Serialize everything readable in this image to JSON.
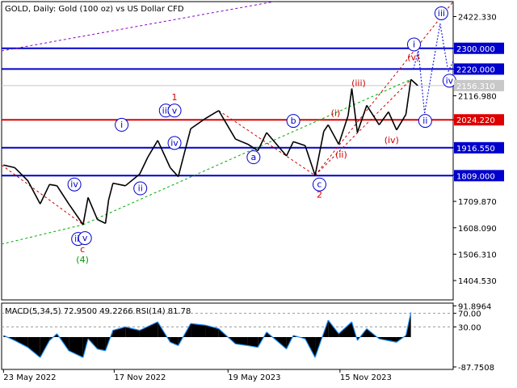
{
  "chart_data": {
    "type": "line",
    "title": "GOLD, Daily:  Gold (100 oz) vs US Dollar CFD",
    "price_axis": {
      "ylim": [
        1330,
        2480
      ],
      "tick_values": [
        1404.53,
        1506.31,
        1608.09,
        1709.87,
        1811.65,
        1916.55,
        2024.22,
        2116.98,
        2156.31,
        2220.0,
        2300.0,
        2422.33
      ],
      "tick_labels": [
        "1404.530",
        "1506.310",
        "1608.090",
        "1709.870",
        "1811.650",
        "1916.550",
        "2024.220",
        "2116.980",
        "2156.310",
        "2220.000",
        "2300.000",
        "2422.330"
      ]
    },
    "time_axis": {
      "range": [
        "2022-05-20",
        "2024-05-15"
      ],
      "labels": [
        {
          "date": "2022-05-23",
          "text": "23 May 2022"
        },
        {
          "date": "2022-11-17",
          "text": "17 Nov 2022"
        },
        {
          "date": "2023-05-19",
          "text": "19 May 2023"
        },
        {
          "date": "2023-11-15",
          "text": "15 Nov 2023"
        }
      ]
    },
    "price_series": [
      [
        "2022-05-23",
        1850
      ],
      [
        "2022-06-10",
        1840
      ],
      [
        "2022-07-01",
        1790
      ],
      [
        "2022-07-21",
        1700
      ],
      [
        "2022-08-05",
        1775
      ],
      [
        "2022-08-17",
        1770
      ],
      [
        "2022-09-05",
        1700
      ],
      [
        "2022-09-28",
        1620
      ],
      [
        "2022-10-06",
        1725
      ],
      [
        "2022-10-21",
        1640
      ],
      [
        "2022-11-03",
        1625
      ],
      [
        "2022-11-08",
        1715
      ],
      [
        "2022-11-15",
        1780
      ],
      [
        "2022-12-05",
        1770
      ],
      [
        "2022-12-28",
        1815
      ],
      [
        "2023-01-10",
        1880
      ],
      [
        "2023-01-26",
        1945
      ],
      [
        "2023-02-15",
        1840
      ],
      [
        "2023-02-28",
        1805
      ],
      [
        "2023-03-20",
        1990
      ],
      [
        "2023-04-13",
        2030
      ],
      [
        "2023-05-04",
        2060
      ],
      [
        "2023-05-31",
        1950
      ],
      [
        "2023-06-20",
        1930
      ],
      [
        "2023-07-06",
        1905
      ],
      [
        "2023-07-20",
        1975
      ],
      [
        "2023-08-21",
        1885
      ],
      [
        "2023-09-01",
        1940
      ],
      [
        "2023-09-20",
        1925
      ],
      [
        "2023-10-06",
        1810
      ],
      [
        "2023-10-20",
        1980
      ],
      [
        "2023-10-27",
        2005
      ],
      [
        "2023-11-13",
        1930
      ],
      [
        "2023-11-28",
        2040
      ],
      [
        "2023-12-04",
        2145
      ],
      [
        "2023-12-13",
        1975
      ],
      [
        "2023-12-28",
        2080
      ],
      [
        "2024-01-17",
        2005
      ],
      [
        "2024-02-01",
        2055
      ],
      [
        "2024-02-14",
        1985
      ],
      [
        "2024-02-29",
        2045
      ],
      [
        "2024-03-08",
        2180
      ],
      [
        "2024-03-19",
        2156.31
      ]
    ],
    "price_lines": [
      {
        "value": 2300.0,
        "label": "2300.000",
        "color": "#0000cc"
      },
      {
        "value": 2220.0,
        "label": "2220.000",
        "color": "#0000cc"
      },
      {
        "value": 2024.22,
        "label": "2024.220",
        "color": "#dd0000"
      },
      {
        "value": 1916.55,
        "label": "1916.550",
        "color": "#0000cc"
      },
      {
        "value": 1809.0,
        "label": "1809.000",
        "color": "#0000cc"
      }
    ],
    "current_price": {
      "value": 2156.31,
      "label": "2156.310"
    },
    "wave_labels": [
      {
        "text": "(4)",
        "date": "2022-09-27",
        "price": 1485,
        "color": "#009900",
        "circle": false
      },
      {
        "text": "c",
        "date": "2022-09-27",
        "price": 1525,
        "color": "#cc0000",
        "circle": false
      },
      {
        "text": "iii",
        "date": "2022-09-20",
        "price": 1565,
        "color": "#0000cc",
        "circle": true
      },
      {
        "text": "v",
        "date": "2022-10-01",
        "price": 1568,
        "color": "#0000cc",
        "circle": true
      },
      {
        "text": "iv",
        "date": "2022-09-14",
        "price": 1775,
        "color": "#0000cc",
        "circle": true
      },
      {
        "text": "i",
        "date": "2022-11-29",
        "price": 2005,
        "color": "#0000cc",
        "circle": true
      },
      {
        "text": "ii",
        "date": "2022-12-29",
        "price": 1760,
        "color": "#0000cc",
        "circle": true
      },
      {
        "text": "iii",
        "date": "2023-02-08",
        "price": 2060,
        "color": "#0000cc",
        "circle": true
      },
      {
        "text": "v",
        "date": "2023-02-22",
        "price": 2060,
        "color": "#0000cc",
        "circle": true
      },
      {
        "text": "iv",
        "date": "2023-02-22",
        "price": 1935,
        "color": "#0000cc",
        "circle": true
      },
      {
        "text": "1",
        "date": "2023-02-22",
        "price": 2110,
        "color": "#cc0000",
        "circle": false
      },
      {
        "text": "a",
        "date": "2023-06-29",
        "price": 1880,
        "color": "#0000cc",
        "circle": true
      },
      {
        "text": "b",
        "date": "2023-09-01",
        "price": 2020,
        "color": "#0000cc",
        "circle": true
      },
      {
        "text": "c",
        "date": "2023-10-13",
        "price": 1775,
        "color": "#0000cc",
        "circle": true
      },
      {
        "text": "2",
        "date": "2023-10-13",
        "price": 1735,
        "color": "#cc0000",
        "circle": false
      },
      {
        "text": "(i)",
        "date": "2023-11-08",
        "price": 2050,
        "color": "#cc0000",
        "circle": false
      },
      {
        "text": "(ii)",
        "date": "2023-11-17",
        "price": 1890,
        "color": "#cc0000",
        "circle": false
      },
      {
        "text": "(iii)",
        "date": "2023-12-15",
        "price": 2165,
        "color": "#cc0000",
        "circle": false
      },
      {
        "text": "(iv)",
        "date": "2024-02-06",
        "price": 1945,
        "color": "#cc0000",
        "circle": false
      },
      {
        "text": "(v)",
        "date": "2024-03-12",
        "price": 2265,
        "color": "#cc0000",
        "circle": false
      },
      {
        "text": "i",
        "date": "2024-03-13",
        "price": 2315,
        "color": "#0000cc",
        "circle": true
      },
      {
        "text": "ii",
        "date": "2024-03-31",
        "price": 2020,
        "color": "#0000cc",
        "circle": true
      },
      {
        "text": "iii",
        "date": "2024-04-26",
        "price": 2435,
        "color": "#0000cc",
        "circle": true
      },
      {
        "text": "iv",
        "date": "2024-05-09",
        "price": 2175,
        "color": "#0000cc",
        "circle": true
      }
    ],
    "forecast_path": [
      [
        "2024-03-12",
        2220
      ],
      [
        "2024-03-20",
        2290
      ],
      [
        "2024-03-30",
        2050
      ],
      [
        "2024-04-24",
        2395
      ],
      [
        "2024-05-07",
        2210
      ],
      [
        "2024-05-15",
        2250
      ]
    ],
    "macd": {
      "label": "MACD(5,34,5) 72.9500 49.2266 RSI(14) 81.78",
      "ylim": [
        -95,
        100
      ],
      "tick_values": [
        91.8964,
        70.0,
        30.0,
        -87.7508
      ],
      "tick_labels": [
        "91.8964",
        "70.00",
        "30.00",
        "-87.7508"
      ],
      "levels": [
        70,
        30
      ],
      "macd_series": [
        [
          "2022-05-23",
          5
        ],
        [
          "2022-06-10",
          -10
        ],
        [
          "2022-07-01",
          -30
        ],
        [
          "2022-07-21",
          -60
        ],
        [
          "2022-08-05",
          -10
        ],
        [
          "2022-08-17",
          10
        ],
        [
          "2022-09-05",
          -40
        ],
        [
          "2022-09-28",
          -60
        ],
        [
          "2022-10-06",
          -5
        ],
        [
          "2022-10-21",
          -35
        ],
        [
          "2022-11-03",
          -40
        ],
        [
          "2022-11-15",
          20
        ],
        [
          "2022-12-05",
          30
        ],
        [
          "2022-12-28",
          20
        ],
        [
          "2023-01-26",
          45
        ],
        [
          "2023-02-15",
          -15
        ],
        [
          "2023-02-28",
          -25
        ],
        [
          "2023-03-20",
          40
        ],
        [
          "2023-04-13",
          35
        ],
        [
          "2023-05-04",
          25
        ],
        [
          "2023-05-31",
          -20
        ],
        [
          "2023-06-20",
          -25
        ],
        [
          "2023-07-06",
          -30
        ],
        [
          "2023-07-20",
          15
        ],
        [
          "2023-08-21",
          -35
        ],
        [
          "2023-09-01",
          5
        ],
        [
          "2023-09-20",
          -5
        ],
        [
          "2023-10-06",
          -60
        ],
        [
          "2023-10-27",
          50
        ],
        [
          "2023-11-13",
          10
        ],
        [
          "2023-12-04",
          45
        ],
        [
          "2023-12-13",
          -10
        ],
        [
          "2023-12-28",
          25
        ],
        [
          "2024-01-17",
          -5
        ],
        [
          "2024-02-14",
          -15
        ],
        [
          "2024-02-29",
          5
        ],
        [
          "2024-03-08",
          72.95
        ]
      ]
    }
  }
}
